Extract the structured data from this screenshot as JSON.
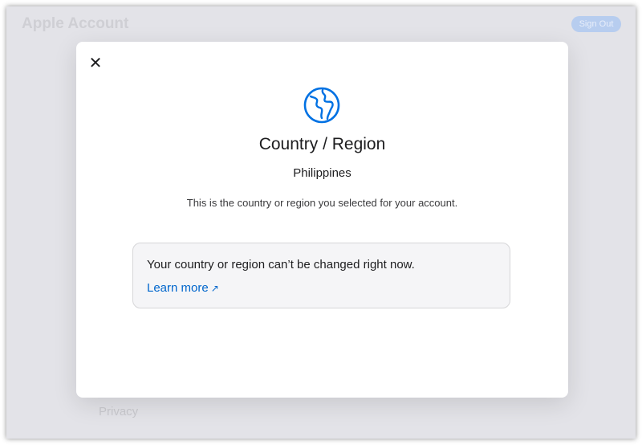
{
  "app": {
    "title": "Apple Account",
    "sign_out_label": "Sign Out",
    "footer_link": "Privacy"
  },
  "modal": {
    "close_icon": "close-icon",
    "title": "Country / Region",
    "country": "Philippines",
    "description": "This is the country or region you selected for your account.",
    "notice_text": "Your country or region can’t be changed right now.",
    "learn_more_label": "Learn more",
    "learn_more_arrow": "↗"
  },
  "colors": {
    "accent": "#0071e3",
    "link": "#0066cc",
    "text": "#1d1d1f",
    "notice_bg": "#f5f5f7"
  }
}
